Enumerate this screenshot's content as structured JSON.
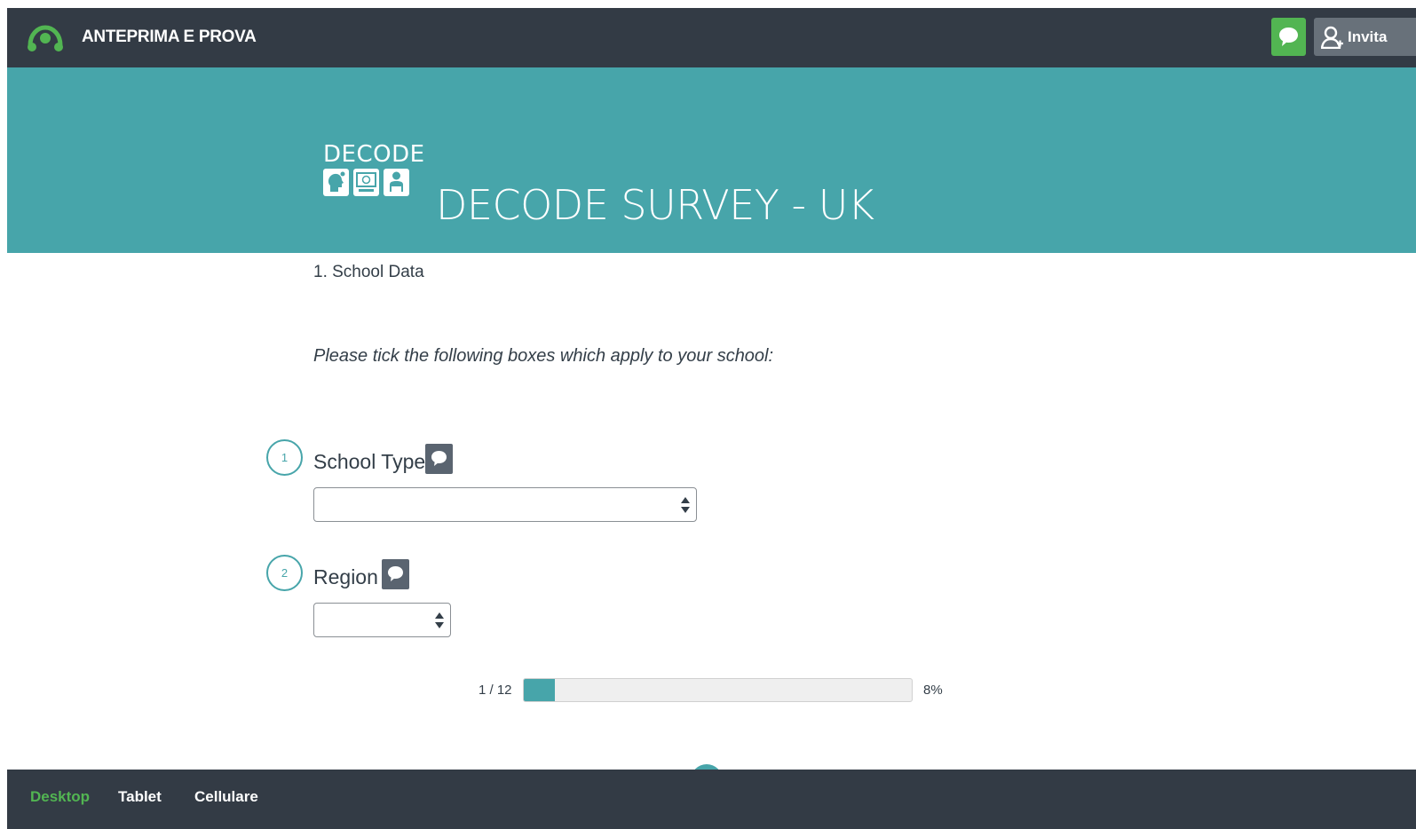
{
  "topbar": {
    "logo_icon": "surveymonkey-logo-icon",
    "title": "ANTEPRIMA E PROVA",
    "chat_icon": "chat-bubble-icon",
    "invite_icon": "person-add-icon",
    "invite_label": "Invita",
    "colors": {
      "bar": "#333b45",
      "chat": "#52b552",
      "invite": "#68717a"
    }
  },
  "banner": {
    "brand_text": "DECODE",
    "brand_icons": [
      "head-profile-icon",
      "computer-screen-icon",
      "student-reader-icon"
    ],
    "survey_title": "DECODE SURVEY - UK",
    "color": "#47a5aa"
  },
  "page": {
    "heading": "1. School Data",
    "instructions": "Please tick the following boxes which apply to your school:"
  },
  "questions": [
    {
      "number": "1",
      "title": "School Type",
      "comment_icon": "comment-icon",
      "selected": ""
    },
    {
      "number": "2",
      "title": "Region",
      "comment_icon": "comment-icon",
      "selected": ""
    }
  ],
  "progress": {
    "label": "1 / 12",
    "percent_label": "8%",
    "fraction": 0.08
  },
  "bottombar": {
    "tabs": [
      {
        "label": "Desktop",
        "active": true
      },
      {
        "label": "Tablet",
        "active": false
      },
      {
        "label": "Cellulare",
        "active": false
      }
    ]
  }
}
